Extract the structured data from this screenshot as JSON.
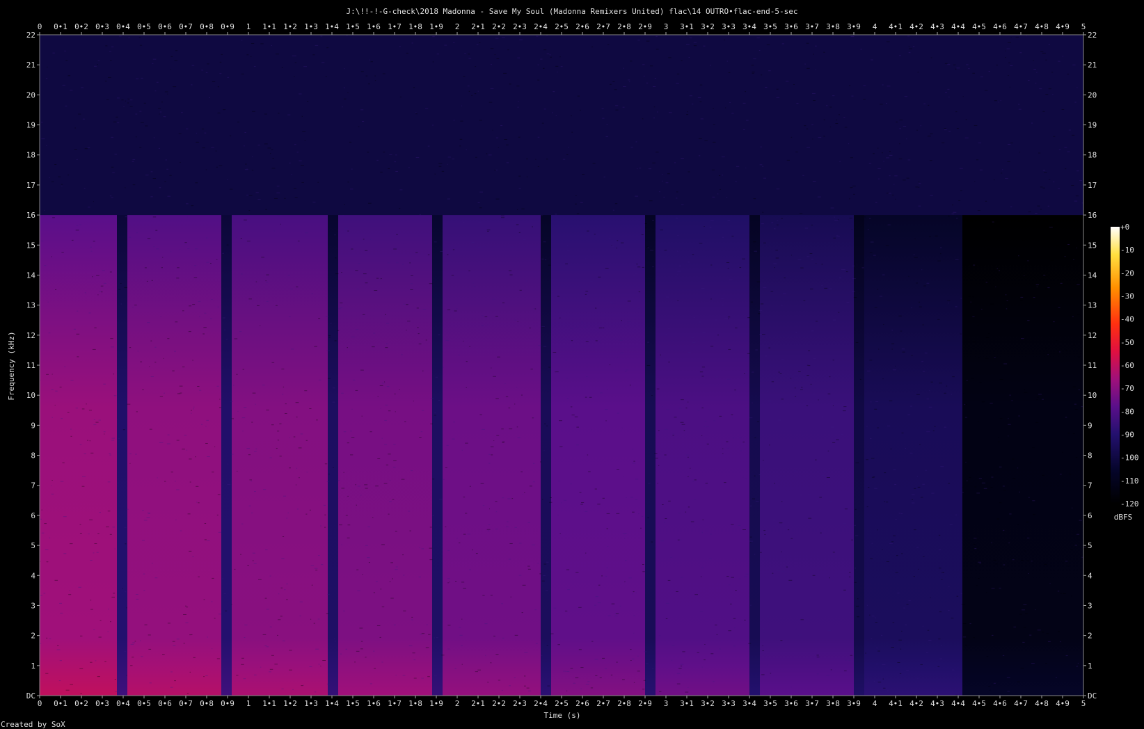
{
  "chart_data": {
    "type": "heatmap",
    "title": "J:\\!!-!-G-check\\2018 Madonna - Save My Soul (Madonna Remixers United) flac\\14 OUTRO•flac-end-5-sec",
    "xlabel": "Time (s)",
    "ylabel": "Frequency (kHz)",
    "xlim": [
      0,
      5
    ],
    "ylim": [
      0,
      22
    ],
    "x_ticks": [
      "0",
      "0•1",
      "0•2",
      "0•3",
      "0•4",
      "0•5",
      "0•6",
      "0•7",
      "0•8",
      "0•9",
      "1",
      "1•1",
      "1•2",
      "1•3",
      "1•4",
      "1•5",
      "1•6",
      "1•7",
      "1•8",
      "1•9",
      "2",
      "2•1",
      "2•2",
      "2•3",
      "2•4",
      "2•5",
      "2•6",
      "2•7",
      "2•8",
      "2•9",
      "3",
      "3•1",
      "3•2",
      "3•3",
      "3•4",
      "3•5",
      "3•6",
      "3•7",
      "3•8",
      "3•9",
      "4",
      "4•1",
      "4•2",
      "4•3",
      "4•4",
      "4•5",
      "4•6",
      "4•7",
      "4•8",
      "4•9",
      "5"
    ],
    "y_ticks": [
      "DC",
      "1",
      "2",
      "3",
      "4",
      "5",
      "6",
      "7",
      "8",
      "9",
      "10",
      "11",
      "12",
      "13",
      "14",
      "15",
      "16",
      "17",
      "18",
      "19",
      "20",
      "21",
      "22"
    ],
    "colorbar": {
      "label": "dBFS",
      "ticks": [
        "+0",
        "-10",
        "-20",
        "-30",
        "-40",
        "-50",
        "-60",
        "-70",
        "-80",
        "-90",
        "-100",
        "-110",
        "-120"
      ],
      "range": [
        -120,
        0
      ]
    },
    "lowpass_cutoff_khz": 16,
    "noise_floor_dbfs": -100,
    "segments": [
      {
        "start": 0.0,
        "end": 0.37,
        "level_dbfs": -66
      },
      {
        "start": 0.37,
        "end": 0.42,
        "level_dbfs": -90
      },
      {
        "start": 0.42,
        "end": 0.87,
        "level_dbfs": -68
      },
      {
        "start": 0.87,
        "end": 0.92,
        "level_dbfs": -90
      },
      {
        "start": 0.92,
        "end": 1.38,
        "level_dbfs": -70
      },
      {
        "start": 1.38,
        "end": 1.43,
        "level_dbfs": -92
      },
      {
        "start": 1.43,
        "end": 1.88,
        "level_dbfs": -72
      },
      {
        "start": 1.88,
        "end": 1.93,
        "level_dbfs": -92
      },
      {
        "start": 1.93,
        "end": 2.4,
        "level_dbfs": -74
      },
      {
        "start": 2.4,
        "end": 2.45,
        "level_dbfs": -94
      },
      {
        "start": 2.45,
        "end": 2.9,
        "level_dbfs": -77
      },
      {
        "start": 2.9,
        "end": 2.95,
        "level_dbfs": -95
      },
      {
        "start": 2.95,
        "end": 3.4,
        "level_dbfs": -80
      },
      {
        "start": 3.4,
        "end": 3.45,
        "level_dbfs": -96
      },
      {
        "start": 3.45,
        "end": 3.9,
        "level_dbfs": -84
      },
      {
        "start": 3.9,
        "end": 3.95,
        "level_dbfs": -98
      },
      {
        "start": 3.95,
        "end": 4.42,
        "level_dbfs": -94
      },
      {
        "start": 4.42,
        "end": 5.0,
        "level_dbfs": -112
      }
    ],
    "grid": false
  },
  "footer": {
    "credit": "Created by SoX"
  }
}
